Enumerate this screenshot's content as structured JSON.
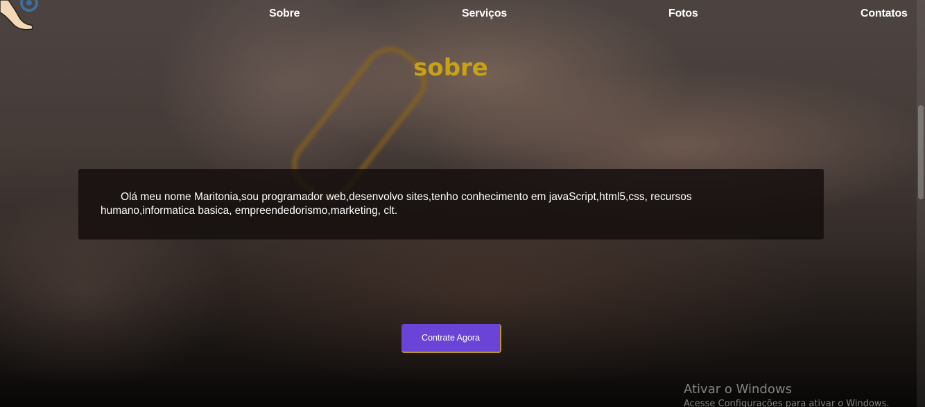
{
  "nav": {
    "items": [
      {
        "label": "Sobre"
      },
      {
        "label": "Serviços"
      },
      {
        "label": "Fotos"
      },
      {
        "label": "Contatos"
      }
    ]
  },
  "logo": {
    "icon": "leg-wax-logo-icon"
  },
  "section": {
    "title": "sobre",
    "text": "Olá meu nome Maritonia,sou programador web,desenvolvo sites,tenho conhecimento em javaScript,html5,css, recursos humano,informatica basica, empreendedorismo,marketing, clt."
  },
  "cta": {
    "label": "Contrate Agora"
  },
  "watermark": {
    "title": "Ativar o Windows",
    "subtitle": "Acesse Configurações para ativar o Windows."
  },
  "colors": {
    "title": "#c7a216",
    "button": "#6a44d6",
    "button_border": "#b8972a"
  }
}
